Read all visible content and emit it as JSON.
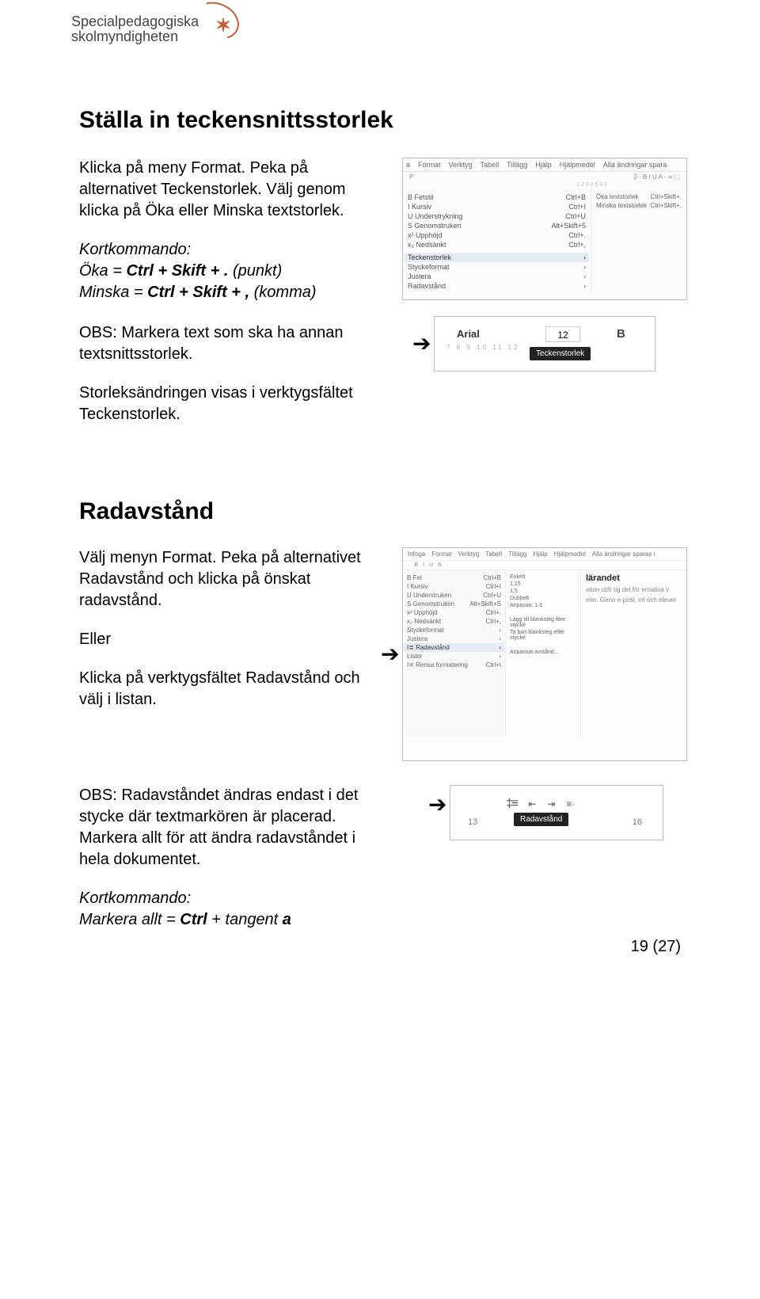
{
  "logo": {
    "line1": "Specialpedagogiska",
    "line2": "skolmyndigheten"
  },
  "sections": {
    "s1": {
      "title": "Ställa in teckensnittsstorlek",
      "p1a": "Klicka på meny Format. Peka på alternativet Teckenstorlek. Välj genom klicka på Öka eller Minska textstorlek.",
      "kort_label": "Kortkommando:",
      "kort_line1_a": "Öka = ",
      "kort_line1_b": "Ctrl + Skift + .",
      "kort_line1_c": " (punkt)",
      "kort_line2_a": "Minska = ",
      "kort_line2_b": "Ctrl + Skift + ,",
      "kort_line2_c": " (komma)",
      "obs": "OBS: Markera text som ska ha annan textsnittsstorlek.",
      "p3": "Storleksändringen visas i verktygsfältet Teckenstorlek."
    },
    "s2": {
      "title": "Radavstånd",
      "p1": "Välj menyn Format. Peka på alternativet Radavstånd och klicka på önskat radavstånd.",
      "eller": "Eller",
      "p2": "Klicka på verktygsfältet Radavstånd och välj i listan.",
      "p3": "OBS: Radavståndet ändras endast i det stycke där textmarkören är placerad. Markera allt för att ändra radavståndet i hela dokumentet.",
      "kort_label": "Kortkommando:",
      "kort_a": "Markera allt = ",
      "kort_b": "Ctrl",
      "kort_c": " + tangent ",
      "kort_d": "a"
    }
  },
  "shot1": {
    "menubar": [
      "a",
      "Format",
      "Verktyg",
      "Tabell",
      "Tillägg",
      "Hjälp",
      "Hjälpmedel",
      "Alla ändringar spara"
    ],
    "left_items": [
      {
        "icon": "B",
        "label": "Fetstil",
        "kb": "Ctrl+B"
      },
      {
        "icon": "I",
        "label": "Kursiv",
        "kb": "Ctrl+I"
      },
      {
        "icon": "U",
        "label": "Understrykning",
        "kb": "Ctrl+U"
      },
      {
        "icon": "S",
        "label": "Genomstruken",
        "kb": "Alt+Skift+5"
      },
      {
        "icon": "x²",
        "label": "Upphöjd",
        "kb": "Ctrl+."
      },
      {
        "icon": "x₂",
        "label": "Nedsänkt",
        "kb": "Ctrl+,"
      }
    ],
    "sel": "Teckenstorlek",
    "below_sel": [
      "Styckeformat",
      "Justera",
      "Radavstånd"
    ],
    "right_items": [
      {
        "label": "Öka textstorlek",
        "kb": "Ctrl+Skift+."
      },
      {
        "label": "Minska textstorlek",
        "kb": "Ctrl+Skift+,"
      }
    ],
    "toolbar_nums": "2   ·   B  I  U  A ·  ∞  ⬚",
    "ruler": "1   2   3   4   5   6   7"
  },
  "shot2": {
    "font": "Arial",
    "size": "12",
    "bold": "B",
    "tooltip": "Teckenstorlek",
    "ruler": "7   8   9   10   11   12"
  },
  "shot3": {
    "topbar": [
      "Infoga",
      "Format",
      "Verktyg",
      "Tabell",
      "Tillägg",
      "Hjälp",
      "Hjälpmedel",
      "Alla ändringar sparas i"
    ],
    "ribbon": [
      "·",
      "B",
      "I",
      "U",
      "A",
      "·"
    ],
    "left": [
      {
        "l": "B  Fet",
        "k": "Ctrl+B"
      },
      {
        "l": "I  Kursiv",
        "k": "Ctrl+I"
      },
      {
        "l": "U  Understruken",
        "k": "Ctrl+U"
      },
      {
        "l": "S  Genomstruken",
        "k": "Alt+Skift+S"
      },
      {
        "l": "x²  Upphöjd",
        "k": "Ctrl+."
      },
      {
        "l": "x₂  Nedsänkt",
        "k": "Ctrl+,"
      },
      {
        "l": "Styckeformat",
        "k": "›"
      },
      {
        "l": "Justera",
        "k": "›"
      }
    ],
    "sel": {
      "l": "I≣  Radavstånd",
      "k": "›"
    },
    "after": [
      {
        "l": "Listor",
        "k": "›"
      },
      {
        "l": "I✕  Rensa formatering",
        "k": "Ctrl+\\"
      },
      {
        "l": "",
        "k": ""
      },
      {
        "l": "",
        "k": ""
      }
    ],
    "mid": [
      "Enkelt",
      "1,15",
      "1,5",
      "Dubbelt",
      "Anpassa: 1.3",
      "",
      "Lägg till blanksteg före stycke",
      "Ta bort blanksteg efter stycke",
      "",
      "Anpassat avstånd..."
    ],
    "right_heading": "lärandet",
    "right_body": "ation utifr  tig del för  ernativa v  eter. Geno  e-post, int  och elever"
  },
  "shot4": {
    "tooltip": "Radavstånd",
    "num13": "13",
    "num16": "16"
  },
  "page_number": "19 (27)"
}
